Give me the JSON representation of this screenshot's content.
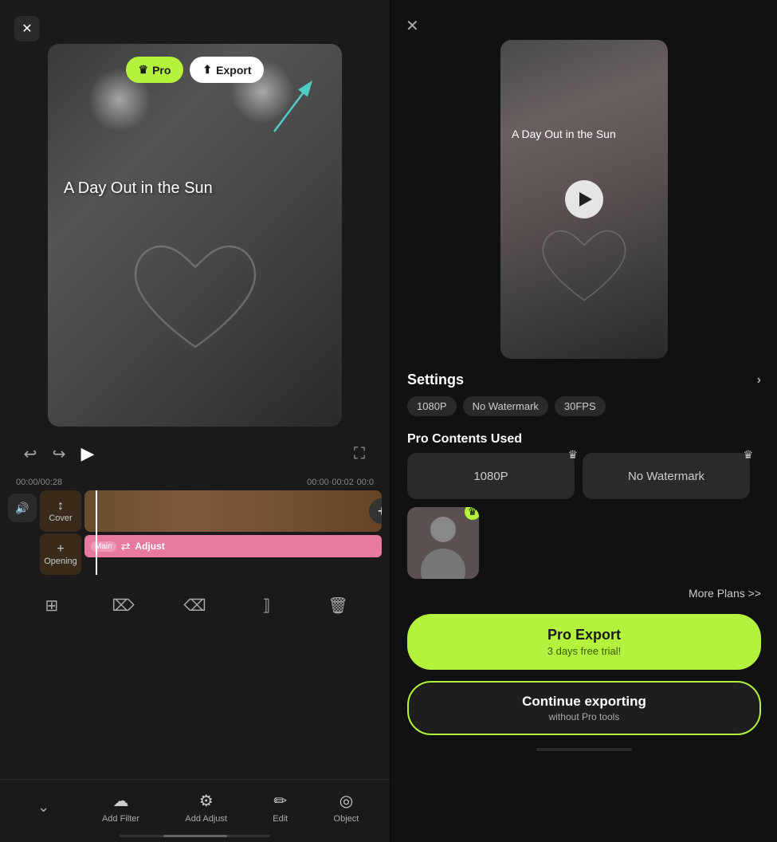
{
  "left": {
    "video_title": "A Day Out in the Sun",
    "pro_btn": "Pro",
    "export_btn": "Export",
    "time_current": "00:00",
    "time_total": "00:28",
    "time_marks": [
      "00:00",
      "00:02",
      "00:0"
    ],
    "cover_label": "Cover",
    "opening_label": "Opening",
    "main_label": "Main",
    "adjust_label": "Adjust",
    "bottom_tools": [
      "Add Filter",
      "Add Adjust",
      "Edit",
      "Object"
    ]
  },
  "right": {
    "close_label": "×",
    "video_title": "A Day Out in the Sun",
    "settings_title": "Settings",
    "settings_tags": [
      "1080P",
      "No Watermark",
      "30FPS"
    ],
    "pro_contents_title": "Pro Contents Used",
    "pro_items": [
      {
        "label": "1080P",
        "type": "large"
      },
      {
        "label": "No Watermark",
        "type": "large"
      },
      {
        "label": "photo",
        "type": "small"
      }
    ],
    "more_plans": "More Plans >>",
    "pro_export_main": "Pro Export",
    "pro_export_sub": "3 days free trial!",
    "continue_main": "Continue exporting",
    "continue_sub": "without Pro tools"
  }
}
